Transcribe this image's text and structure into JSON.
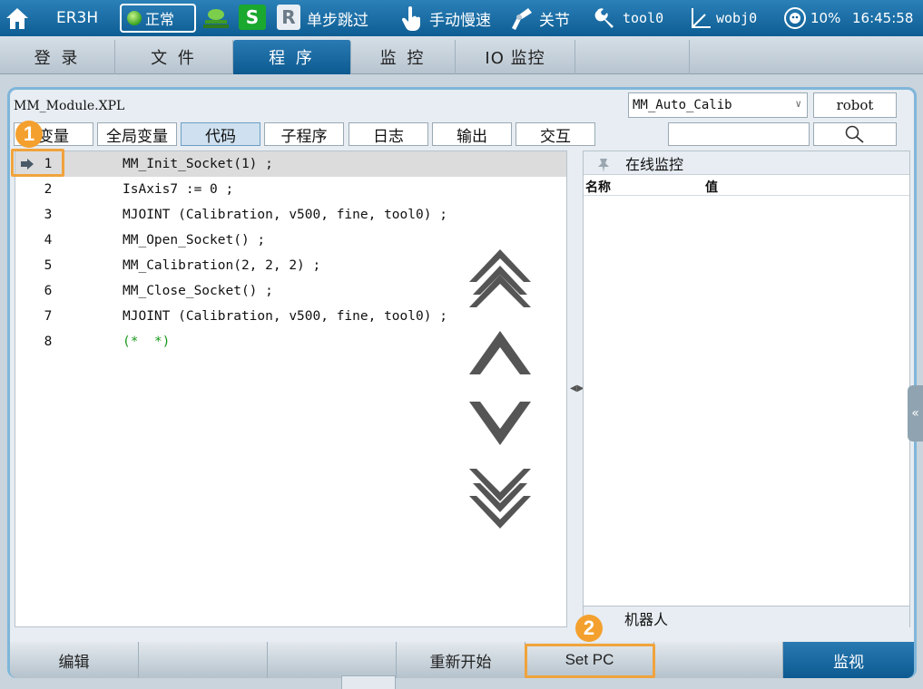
{
  "topbar": {
    "robot_name": "ER3H",
    "status": "正常",
    "step_badge": "S",
    "run_badge": "R",
    "step_label": "单步跳过",
    "manual_label": "手动慢速",
    "joint_label": "关节",
    "tool_label": "tool0",
    "wobj_label": "wobj0",
    "speed": "10%",
    "time": "16:45:58"
  },
  "main_tabs": [
    {
      "label": "登 录"
    },
    {
      "label": "文 件"
    },
    {
      "label": "程 序",
      "active": true
    },
    {
      "label": "监 控"
    },
    {
      "label": "IO 监控"
    }
  ],
  "program": {
    "filename": "MM_Module.XPL",
    "routine": "MM_Auto_Calib",
    "robot_button": "robot",
    "subtabs": [
      {
        "label": "变量"
      },
      {
        "label": "全局变量"
      },
      {
        "label": "代码",
        "active": true
      },
      {
        "label": "子程序"
      },
      {
        "label": "日志"
      },
      {
        "label": "输出"
      },
      {
        "label": "交互"
      }
    ],
    "search_value": "",
    "lines": [
      {
        "no": "1",
        "code": "MM_Init_Socket(1) ;",
        "current": true
      },
      {
        "no": "2",
        "code": "IsAxis7 := 0 ;"
      },
      {
        "no": "3",
        "code": "MJOINT (Calibration, v500, fine, tool0) ;"
      },
      {
        "no": "4",
        "code": "MM_Open_Socket() ;"
      },
      {
        "no": "5",
        "code": "MM_Calibration(2, 2, 2) ;"
      },
      {
        "no": "6",
        "code": "MM_Close_Socket() ;"
      },
      {
        "no": "7",
        "code": "MJOINT (Calibration, v500, fine, tool0) ;"
      },
      {
        "no": "8",
        "code": "(*  *)",
        "comment": true
      }
    ]
  },
  "monitor": {
    "title": "在线监控",
    "col_name": "名称",
    "col_value": "值",
    "footer": "机器人"
  },
  "bottom": {
    "edit": "编辑",
    "btn2": "",
    "btn3": "",
    "restart": "重新开始",
    "set_pc": "Set PC",
    "btn6": "",
    "monitor": "监视"
  },
  "callouts": {
    "one": "1",
    "two": "2"
  },
  "colors": {
    "accent": "#0c5a90",
    "callout": "#f4a02e",
    "comment": "#1a9a1a",
    "status_ok": "#3aa320"
  }
}
